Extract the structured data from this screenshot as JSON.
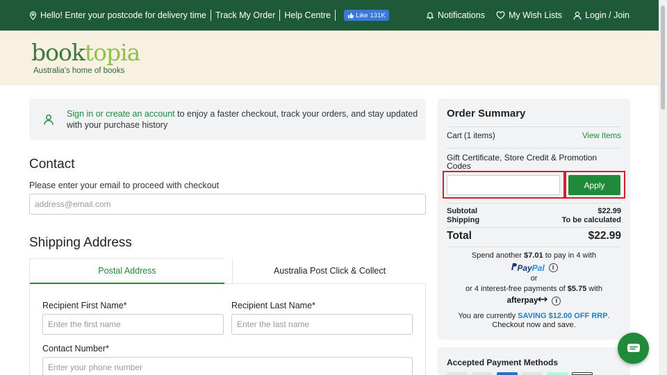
{
  "topbar": {
    "postcode_text": "Hello! Enter your postcode for delivery time",
    "track_order": "Track My Order",
    "help_centre": "Help Centre",
    "like_label": "Like",
    "like_count": "131K",
    "notifications": "Notifications",
    "wish_lists": "My Wish Lists",
    "login": "Login / Join"
  },
  "header": {
    "logo_part1": "book",
    "logo_part2": "topia",
    "tagline": "Australia's home of books"
  },
  "signin": {
    "link_text": "Sign in or create an account",
    "rest_text": " to enjoy a faster checkout, track your orders, and stay updated with your purchase history"
  },
  "contact": {
    "title": "Contact",
    "help": "Please enter your email to proceed with checkout",
    "email_placeholder": "address@email.com"
  },
  "shipping": {
    "title": "Shipping Address",
    "tabs": [
      "Postal Address",
      "Australia Post Click & Collect"
    ],
    "first_name_label": "Recipient First Name*",
    "first_name_placeholder": "Enter the first name",
    "last_name_label": "Recipient Last Name*",
    "last_name_placeholder": "Enter the last name",
    "phone_label": "Contact Number*",
    "phone_placeholder": "Enter your phone number"
  },
  "summary": {
    "title": "Order Summary",
    "cart": "Cart (1 items)",
    "view_items": "View Items",
    "gift_label": "Gift Certificate, Store Credit & Promotion Codes",
    "apply": "Apply",
    "subtotal_label": "Subtotal",
    "subtotal_value": "$22.99",
    "shipping_label": "Shipping",
    "shipping_value": "To be calculated",
    "total_label": "Total",
    "total_value": "$22.99",
    "paypal_pre": "Spend another ",
    "paypal_amount": "$7.01",
    "paypal_post": " to pay in 4 with",
    "paypal_brand1": "Pay",
    "paypal_brand2": "Pal",
    "or": "or",
    "afterpay_pre": "or 4 interest-free payments of ",
    "afterpay_amount": "$5.75",
    "afterpay_post": " with",
    "afterpay_brand": "afterpay",
    "saving_pre": "You are currently ",
    "saving_highlight": "SAVING $12.00 OFF RRP",
    "saving_post": ".",
    "saving_line2": "Checkout now and save."
  },
  "payment_methods": {
    "title": "Accepted Payment Methods"
  },
  "colors": {
    "topbar": "#1f5a38",
    "header_bg": "#f8f0e1",
    "accent_green": "#1e8a3a",
    "highlight_red": "#d61f2c",
    "saving_blue": "#1e7fc2"
  }
}
